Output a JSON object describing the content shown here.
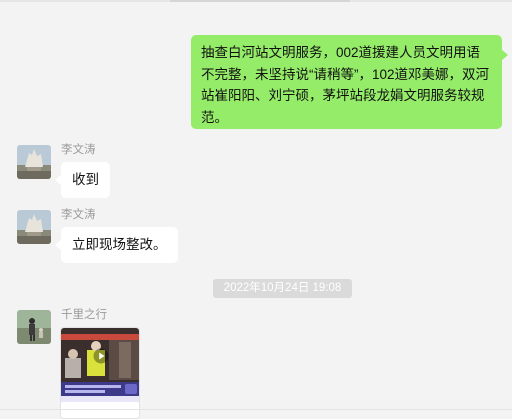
{
  "messages": {
    "outgoing_1": "抽查白河站文明服务，002道援建人员文明用语不完整，未坚持说“请稍等”，102道邓美娜，双河站崔阳阳、刘宁硕，茅坪站段龙娟文明服务较规范。",
    "incoming_1": {
      "sender": "李文涛",
      "text": "收到"
    },
    "incoming_2": {
      "sender": "李文涛",
      "text": "立即现场整改。"
    },
    "timestamp": "2022年10月24日 19:08",
    "incoming_3": {
      "sender": "千里之行",
      "type": "video"
    }
  },
  "colors": {
    "background": "#f3f3f3",
    "outgoing_bubble": "#95ec69",
    "incoming_bubble": "#ffffff"
  }
}
